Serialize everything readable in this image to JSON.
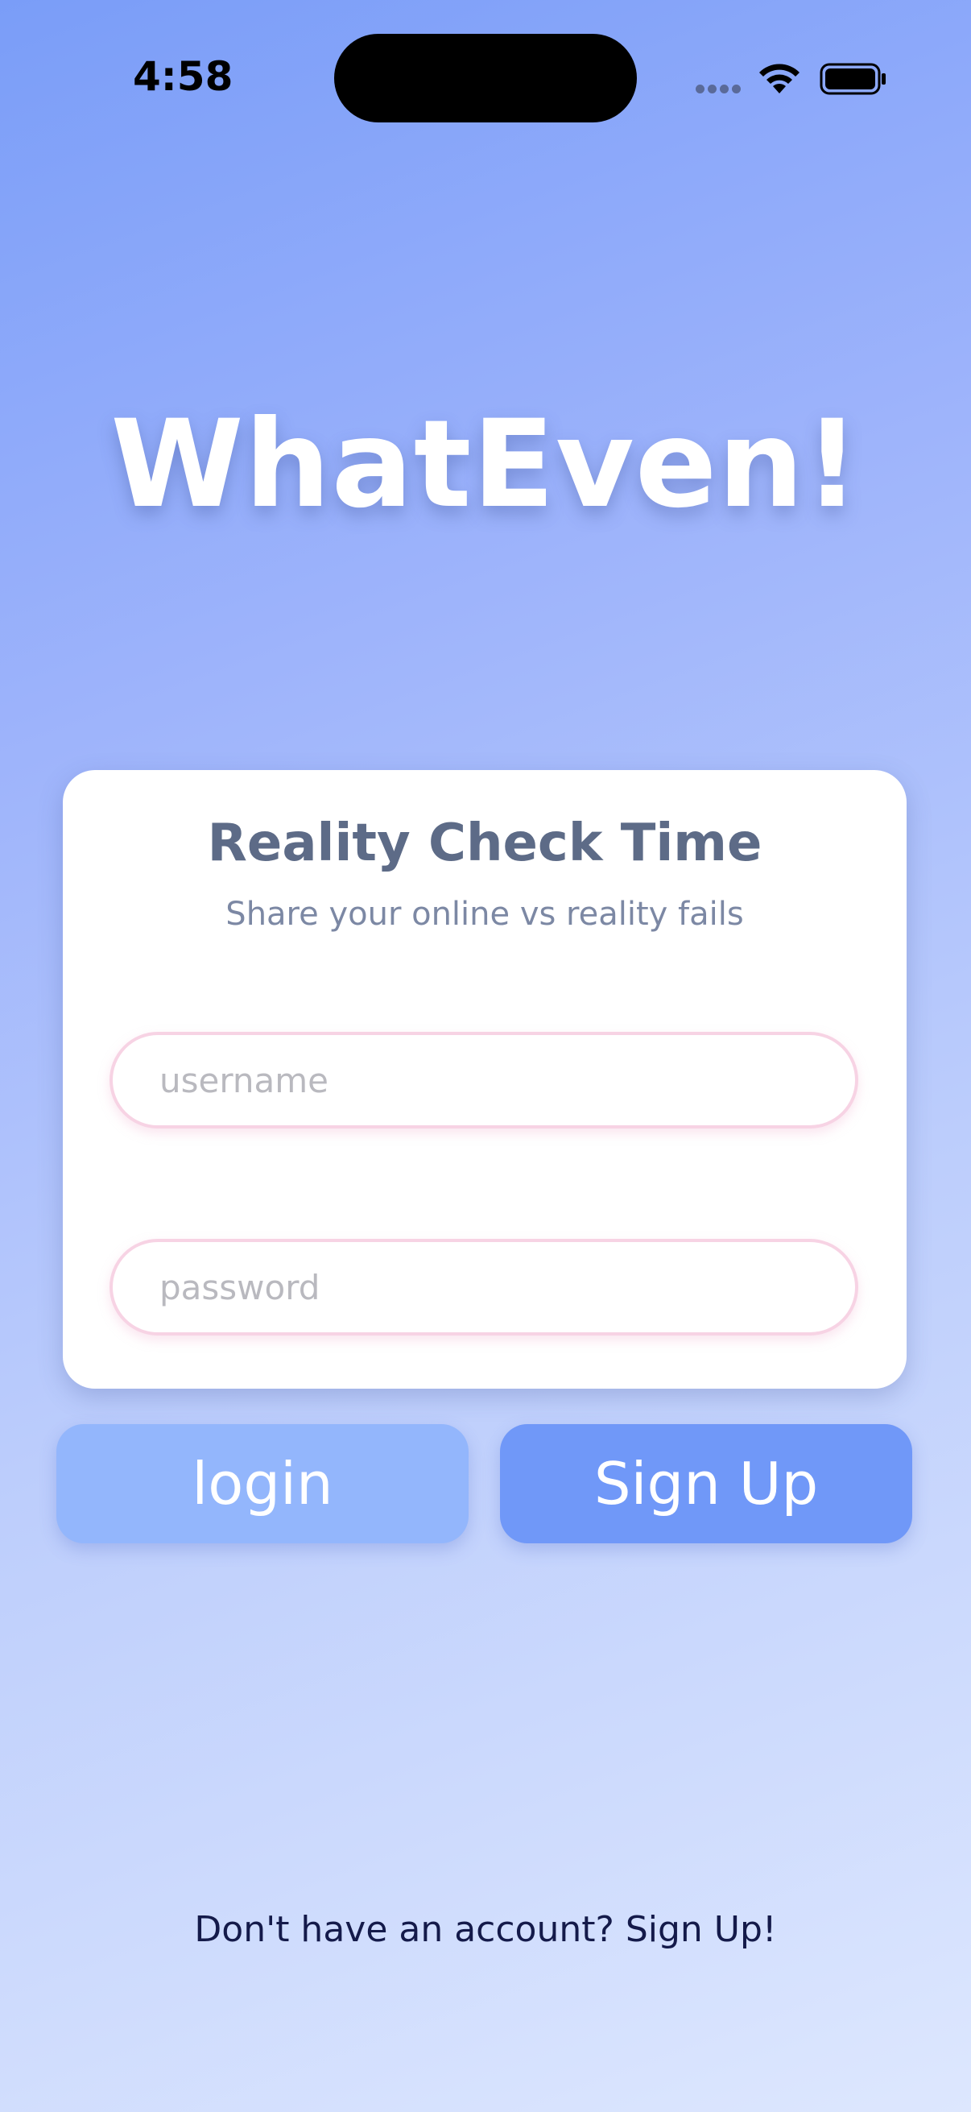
{
  "status_bar": {
    "time": "4:58",
    "icons": [
      "cellular-signal-icon",
      "wifi-icon",
      "battery-icon"
    ]
  },
  "app": {
    "title": "WhatEven!"
  },
  "card": {
    "title": "Reality Check Time",
    "subtitle": "Share your online vs reality fails",
    "username": {
      "placeholder": "username",
      "value": ""
    },
    "password": {
      "placeholder": "password",
      "value": ""
    }
  },
  "buttons": {
    "login_label": "login",
    "signup_label": "Sign Up"
  },
  "footer": {
    "signup_prompt": "Don't have an account? Sign Up!"
  },
  "colors": {
    "background_top": "#7a9df8",
    "background_bottom": "#dde7fe",
    "login_button": "#93b6fc",
    "signup_button": "#7098f8",
    "input_border": "#f7d3e4",
    "card_title": "#5d6b87",
    "footer_text": "#141a4a"
  }
}
